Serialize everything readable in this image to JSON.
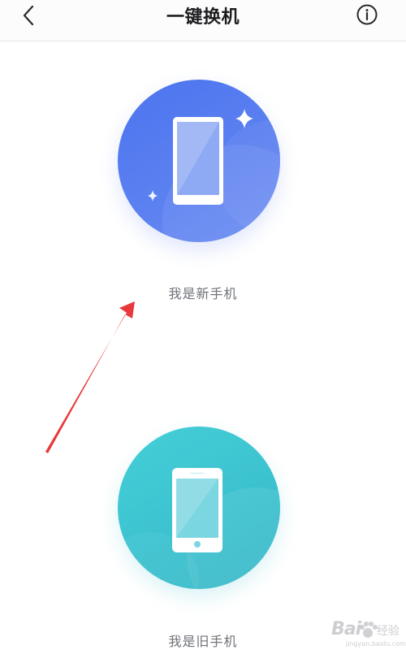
{
  "header": {
    "title": "一键换机",
    "back_icon": "chevron-left-icon",
    "info_icon": "info-circle-icon"
  },
  "options": [
    {
      "label": "我是新手机",
      "icon": "phone-new-icon",
      "color": "#5a7ff0"
    },
    {
      "label": "我是旧手机",
      "icon": "phone-old-icon",
      "color": "#3fc4d1"
    }
  ],
  "annotation": {
    "type": "red-arrow",
    "color": "#e8383a"
  },
  "watermark": {
    "brand": "Bai",
    "suffix": "经验",
    "url": "jingyan.baidu.com"
  }
}
